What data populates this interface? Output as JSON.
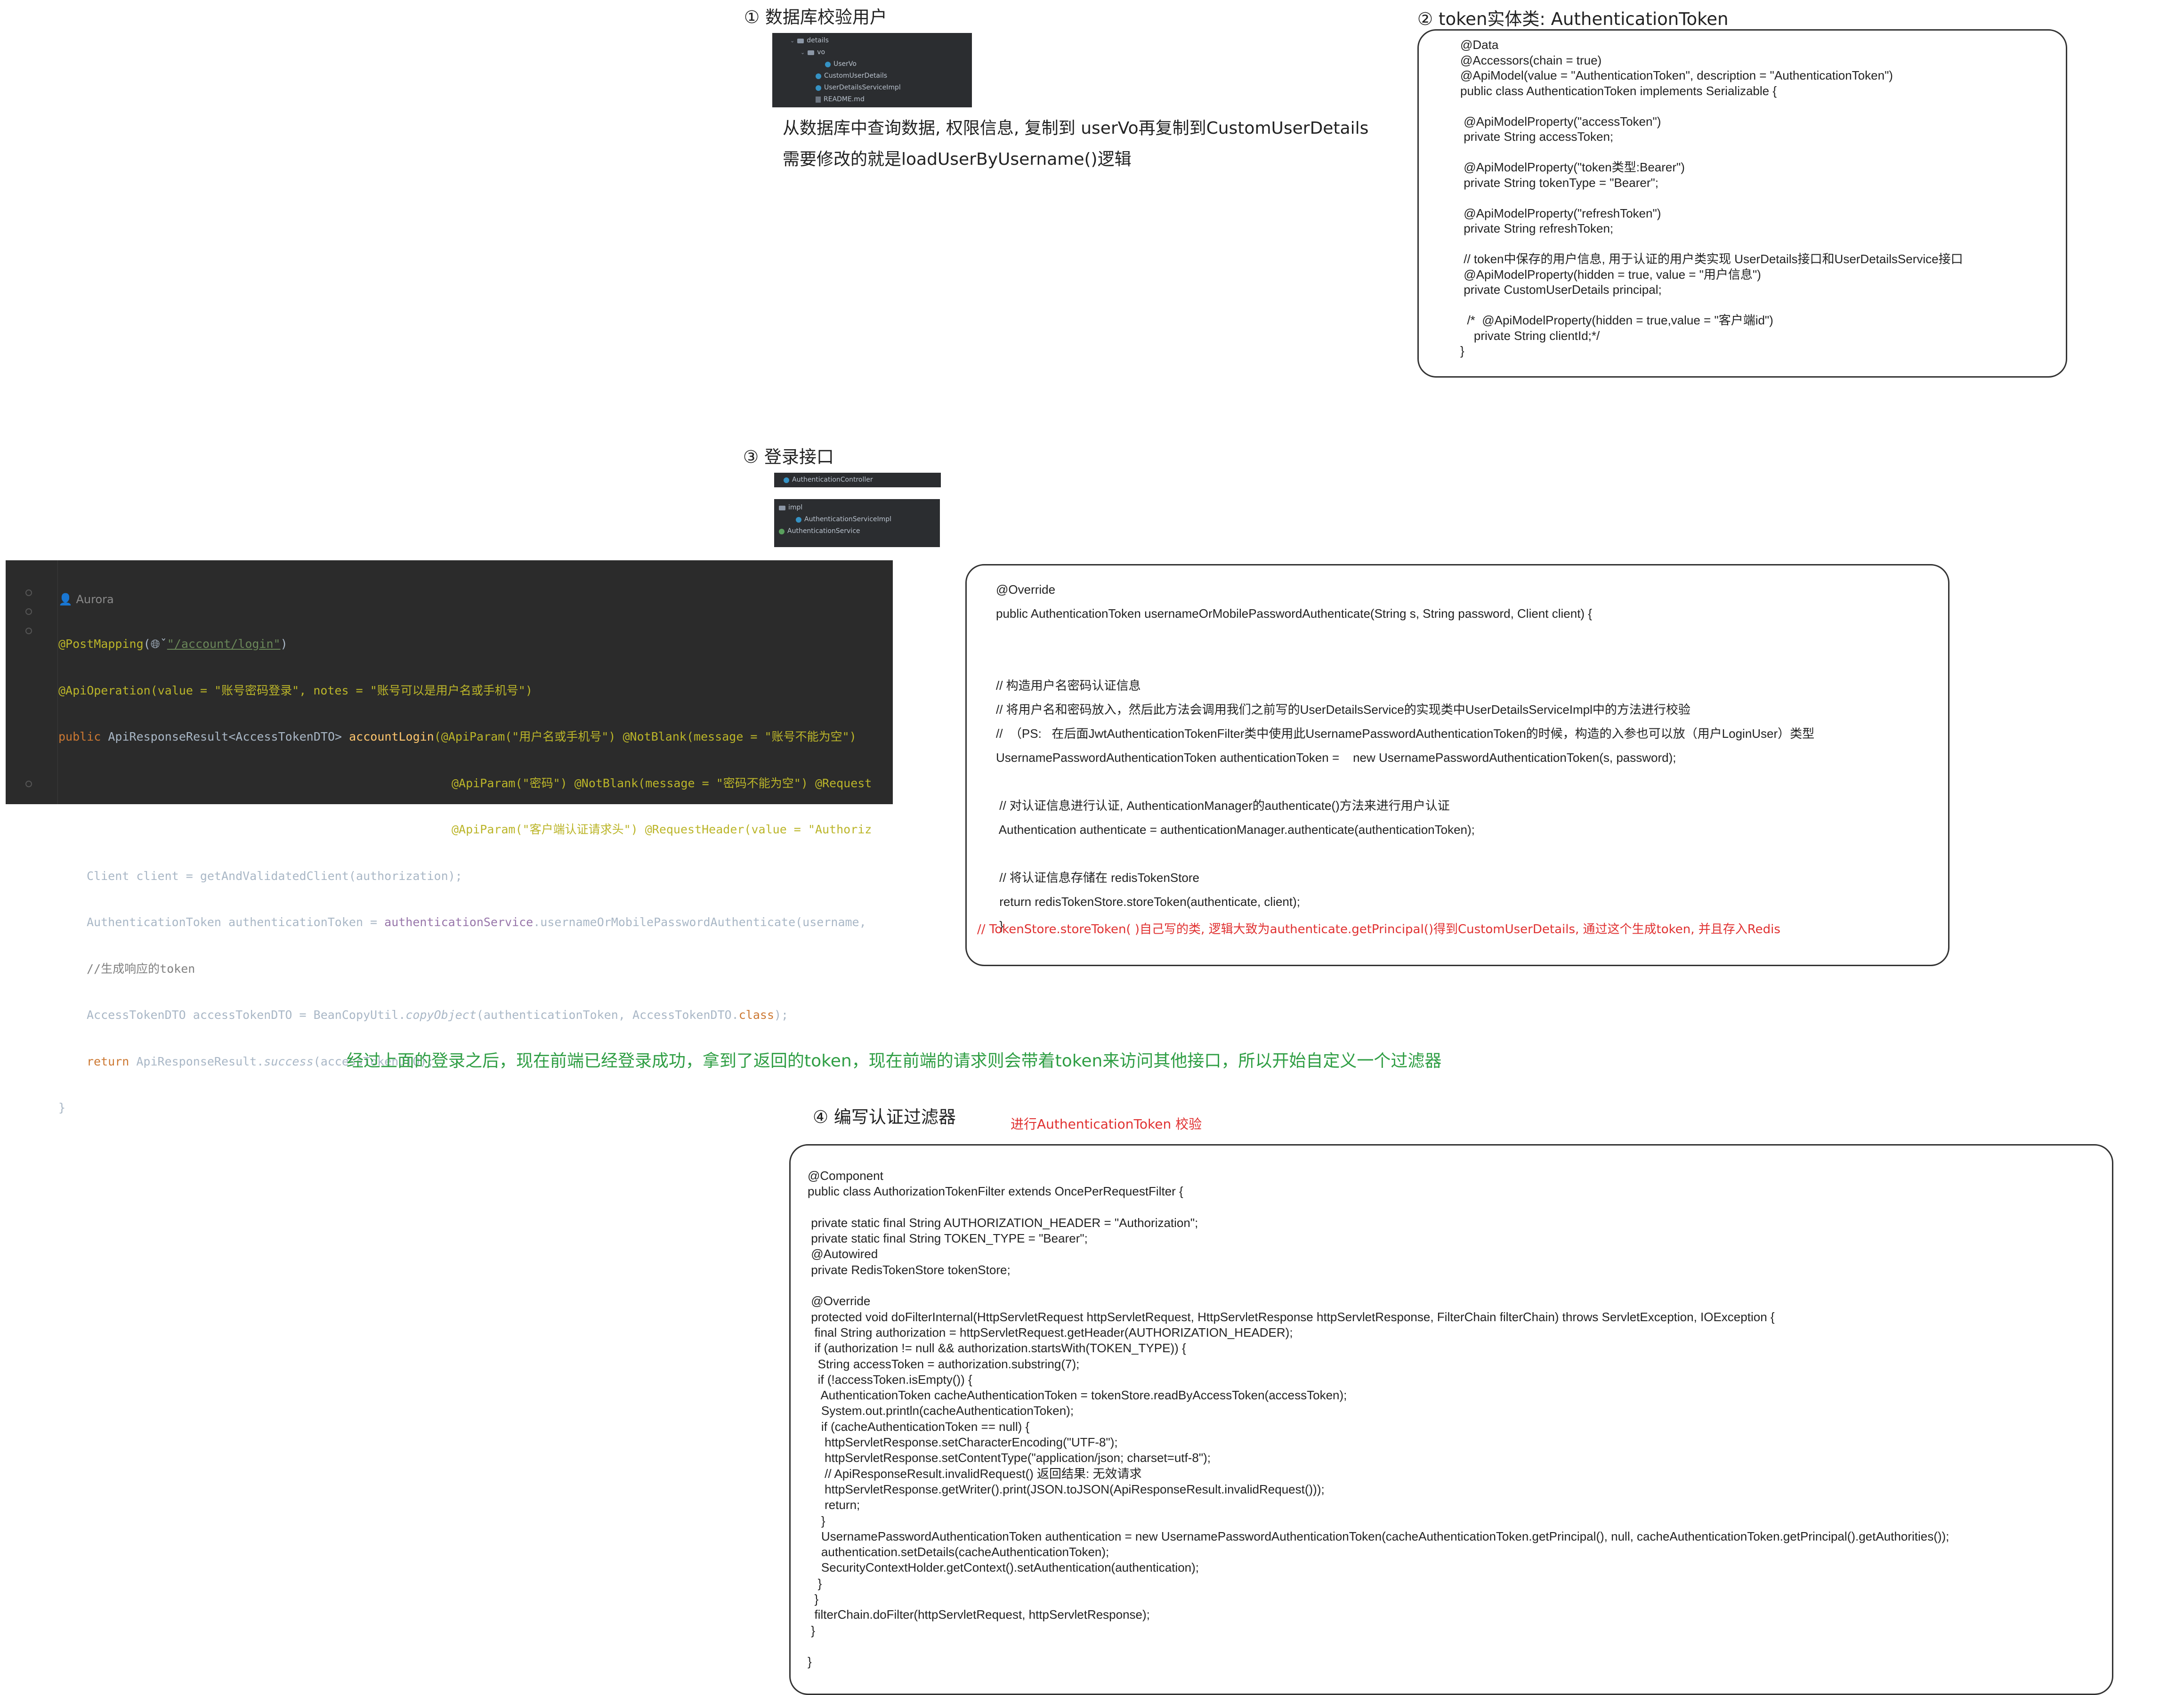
{
  "s1": {
    "title": "① 数据库校验用户",
    "tree": [
      {
        "label": "details",
        "type": "folder"
      },
      {
        "label": "vo",
        "type": "folder"
      },
      {
        "label": "UserVo",
        "type": "class"
      },
      {
        "label": "CustomUserDetails",
        "type": "class"
      },
      {
        "label": "UserDetailsServiceImpl",
        "type": "class"
      },
      {
        "label": "README.md",
        "type": "file"
      }
    ],
    "note1": "从数据库中查询数据, 权限信息, 复制到 userVo再复制到CustomUserDetails",
    "note2": "需要修改的就是loadUserByUsername()逻辑"
  },
  "s2": {
    "title": "② token实体类: AuthenticationToken",
    "lines": [
      "@Data",
      "@Accessors(chain = true)",
      "@ApiModel(value = \"AuthenticationToken\", description = \"AuthenticationToken\")",
      "public class AuthenticationToken implements Serializable {",
      "",
      " @ApiModelProperty(\"accessToken\")",
      " private String accessToken;",
      "",
      " @ApiModelProperty(\"token类型:Bearer\")",
      " private String tokenType = \"Bearer\";",
      "",
      " @ApiModelProperty(\"refreshToken\")",
      " private String refreshToken;",
      "",
      " // token中保存的用户信息, 用于认证的用户类实现 UserDetails接口和UserDetailsService接口",
      " @ApiModelProperty(hidden = true, value = \"用户信息\")",
      " private CustomUserDetails principal;",
      "",
      "  /*  @ApiModelProperty(hidden = true,value = \"客户端id\")",
      "    private String clientId;*/",
      "}"
    ]
  },
  "s3": {
    "title": "③ 登录接口",
    "tree_top": [
      {
        "label": "AuthenticationController",
        "type": "class"
      }
    ],
    "tree_bottom": [
      {
        "label": "impl",
        "type": "folder"
      },
      {
        "label": "AuthenticationServiceImpl",
        "type": "class"
      },
      {
        "label": "AuthenticationService",
        "type": "iface"
      }
    ],
    "ide": {
      "author": "Aurora",
      "l1_ann": "@PostMapping",
      "l1_rest": "(",
      "l1_url": "\"/account/login\"",
      "l1_end": ")",
      "l2": "@ApiOperation(value = \"账号密码登录\", notes = \"账号可以是用户名或手机号\")",
      "l3_a": "public ",
      "l3_b": "ApiResponseResult<AccessTokenDTO> ",
      "l3_fn": "accountLogin",
      "l3_c": "(@ApiParam(\"用户名或手机号\") @NotBlank(message = \"账号不能为空\")",
      "l4": "@ApiParam(\"密码\") @NotBlank(message = \"密码不能为空\") @Request",
      "l5": "@ApiParam(\"客户端认证请求头\") @RequestHeader(value = \"Authoriz",
      "l6": "Client client = getAndValidatedClient(authorization);",
      "l7_a": "AuthenticationToken authenticationToken = ",
      "l7_field": "authenticationService",
      "l7_b": ".usernameOrMobilePasswordAuthenticate(username,",
      "l8": "//生成响应的token",
      "l9_a": "AccessTokenDTO accessTokenDTO = BeanCopyUtil.",
      "l9_it": "copyObject",
      "l9_b": "(authenticationToken, AccessTokenDTO.",
      "l9_kw": "class",
      "l9_c": ");",
      "l10_kw": "return ",
      "l10_a": "ApiResponseResult.",
      "l10_it": "success",
      "l10_b": "(accessTokenDTO);",
      "l11": "}"
    },
    "box_lines": [
      "@Override",
      "public AuthenticationToken usernameOrMobilePasswordAuthenticate(String s, String password, Client client) {",
      "",
      "",
      "// 构造用户名密码认证信息",
      "// 将用户名和密码放入，然后此方法会调用我们之前写的UserDetailsService的实现类中UserDetailsServiceImpl中的方法进行校验",
      "//  （PS:   在后面JwtAuthenticationTokenFilter类中使用此UsernamePasswordAuthenticationToken的时候，构造的入参也可以放（用户LoginUser）类型",
      "UsernamePasswordAuthenticationToken authenticationToken =    new UsernamePasswordAuthenticationToken(s, password);",
      "",
      " // 对认证信息进行认证, AuthenticationManager的authenticate()方法来进行用户认证",
      " Authentication authenticate = authenticationManager.authenticate(authenticationToken);",
      "",
      " // 将认证信息存储在 redisTokenStore",
      " return redisTokenStore.storeToken(authenticate, client);",
      " }"
    ],
    "red_note": "// TokenStore.storeToken( )自己写的类, 逻辑大致为authenticate.getPrincipal()得到CustomUserDetails,   通过这个生成token, 并且存入Redis"
  },
  "green_note": "经过上面的登录之后，现在前端已经登录成功，拿到了返回的token，现在前端的请求则会带着token来访问其他接口，所以开始自定义一个过滤器",
  "s4": {
    "title": "④ 编写认证过滤器",
    "subtitle": "进行AuthenticationToken 校验",
    "lines": [
      "@Component",
      "public class AuthorizationTokenFilter extends OncePerRequestFilter {",
      "",
      " private static final String AUTHORIZATION_HEADER = \"Authorization\";",
      " private static final String TOKEN_TYPE = \"Bearer\";",
      " @Autowired",
      " private RedisTokenStore tokenStore;",
      "",
      " @Override",
      " protected void doFilterInternal(HttpServletRequest httpServletRequest, HttpServletResponse httpServletResponse, FilterChain filterChain) throws ServletException, IOException {",
      "  final String authorization = httpServletRequest.getHeader(AUTHORIZATION_HEADER);",
      "  if (authorization != null && authorization.startsWith(TOKEN_TYPE)) {",
      "   String accessToken = authorization.substring(7);",
      "   if (!accessToken.isEmpty()) {",
      "    AuthenticationToken cacheAuthenticationToken = tokenStore.readByAccessToken(accessToken);",
      "    System.out.println(cacheAuthenticationToken);",
      "    if (cacheAuthenticationToken == null) {",
      "     httpServletResponse.setCharacterEncoding(\"UTF-8\");",
      "     httpServletResponse.setContentType(\"application/json; charset=utf-8\");",
      "     // ApiResponseResult.invalidRequest() 返回结果: 无效请求",
      "     httpServletResponse.getWriter().print(JSON.toJSON(ApiResponseResult.invalidRequest()));",
      "     return;",
      "    }",
      "    UsernamePasswordAuthenticationToken authentication = new UsernamePasswordAuthenticationToken(cacheAuthenticationToken.getPrincipal(), null, cacheAuthenticationToken.getPrincipal().getAuthorities());",
      "    authentication.setDetails(cacheAuthenticationToken);",
      "    SecurityContextHolder.getContext().setAuthentication(authentication);",
      "   }",
      "  }",
      "  filterChain.doFilter(httpServletRequest, httpServletResponse);",
      " }",
      "",
      "}"
    ]
  }
}
